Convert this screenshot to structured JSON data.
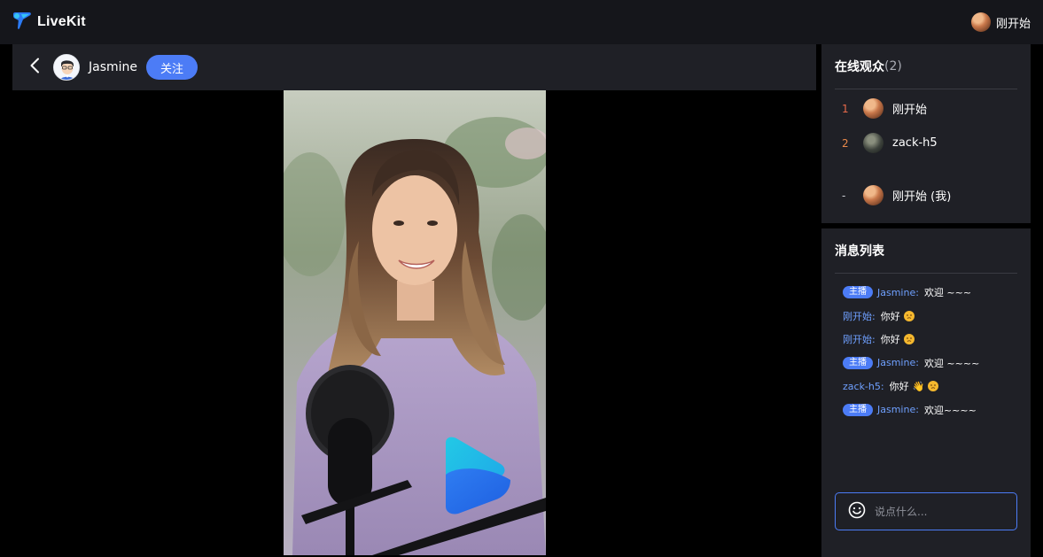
{
  "app": {
    "name": "LiveKit"
  },
  "topbar": {
    "user_name": "刚开始"
  },
  "host": {
    "name": "Jasmine",
    "follow_label": "关注"
  },
  "audience": {
    "title": "在线观众",
    "count": "(2)",
    "items": [
      {
        "rank": "1",
        "name": "刚开始",
        "rank_color": "#e86a4b",
        "avatar": "warm"
      },
      {
        "rank": "2",
        "name": "zack-h5",
        "rank_color": "#e8894b",
        "avatar": "dark"
      }
    ],
    "self": {
      "rank": "-",
      "name": "刚开始 (我)",
      "avatar": "warm"
    }
  },
  "messages": {
    "title": "消息列表",
    "host_badge": "主播",
    "items": [
      {
        "is_host": true,
        "user": "Jasmine:",
        "text": "欢迎 ~~~",
        "emoji": []
      },
      {
        "is_host": false,
        "user": "刚开始:",
        "text": "你好",
        "emoji": [
          "slightly-frowning-face"
        ]
      },
      {
        "is_host": false,
        "user": "刚开始:",
        "text": "你好",
        "emoji": [
          "slightly-frowning-face"
        ]
      },
      {
        "is_host": true,
        "user": "Jasmine:",
        "text": "欢迎 ~~~~",
        "emoji": []
      },
      {
        "is_host": false,
        "user": "zack-h5:",
        "text": "你好",
        "emoji": [
          "waving-hand",
          "slightly-frowning-face"
        ]
      },
      {
        "is_host": true,
        "user": "Jasmine:",
        "text": "欢迎~~~~",
        "emoji": []
      }
    ]
  },
  "chat_input": {
    "placeholder": "说点什么..."
  },
  "colors": {
    "accent": "#4c7cf6",
    "username": "#6fa0ff",
    "panel_bg": "#1f2026",
    "topbar_bg": "#15161b"
  }
}
